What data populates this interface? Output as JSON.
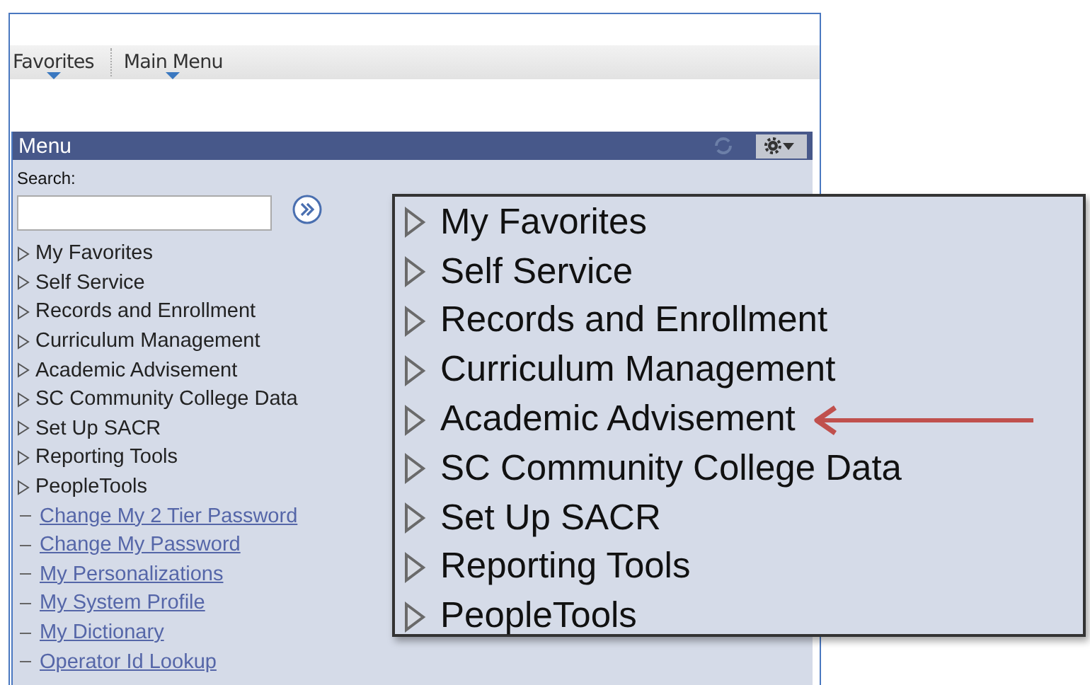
{
  "nav": [
    {
      "label": "Favorites"
    },
    {
      "label": "Main Menu"
    }
  ],
  "menu": {
    "title": "Menu",
    "search_label": "Search:",
    "folders": [
      {
        "label": "My Favorites"
      },
      {
        "label": "Self Service"
      },
      {
        "label": "Records and Enrollment"
      },
      {
        "label": "Curriculum Management"
      },
      {
        "label": "Academic Advisement"
      },
      {
        "label": "SC Community College Data"
      },
      {
        "label": "Set Up SACR"
      },
      {
        "label": "Reporting Tools"
      },
      {
        "label": "PeopleTools"
      }
    ],
    "links": [
      {
        "label": "Change My 2 Tier Password"
      },
      {
        "label": "Change My Password"
      },
      {
        "label": "My Personalizations"
      },
      {
        "label": "My System Profile"
      },
      {
        "label": "My Dictionary"
      },
      {
        "label": "Operator Id Lookup"
      }
    ]
  },
  "callout": {
    "items": [
      {
        "label": "My Favorites",
        "pointed": false
      },
      {
        "label": "Self Service",
        "pointed": false
      },
      {
        "label": "Records and Enrollment",
        "pointed": false
      },
      {
        "label": "Curriculum Management",
        "pointed": false
      },
      {
        "label": "Academic Advisement",
        "pointed": true
      },
      {
        "label": "SC Community College Data",
        "pointed": false
      },
      {
        "label": "Set Up SACR",
        "pointed": false
      },
      {
        "label": "Reporting Tools",
        "pointed": false
      },
      {
        "label": "PeopleTools",
        "pointed": false
      }
    ]
  }
}
